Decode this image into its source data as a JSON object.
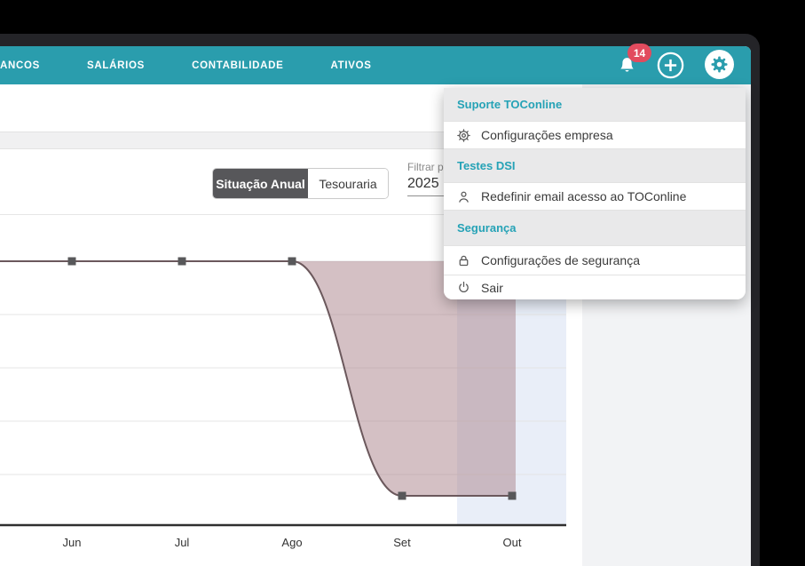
{
  "navbar": {
    "color": "#2A9DAD",
    "items": [
      {
        "label": "ANCOS"
      },
      {
        "label": "SALÁRIOS"
      },
      {
        "label": "CONTABILIDADE"
      },
      {
        "label": "ATIVOS"
      }
    ],
    "notifications": {
      "count": "14",
      "badge_color": "#E24B5E"
    }
  },
  "toolbar": {
    "tabs": [
      {
        "label": "Situação Anual",
        "active": true
      },
      {
        "label": "Tesouraria",
        "active": false
      }
    ],
    "filter": {
      "label": "Filtrar po",
      "value": "2025"
    }
  },
  "menu": {
    "header_color": "#25A2B6",
    "sections": [
      {
        "header": "Suporte TOConline",
        "items": [
          {
            "icon": "gear-icon",
            "label": "Configurações empresa"
          }
        ]
      },
      {
        "header": "Testes DSI",
        "items": [
          {
            "icon": "user-icon",
            "label": "Redefinir email acesso ao TOConline"
          }
        ]
      },
      {
        "header": "Segurança",
        "items": [
          {
            "icon": "lock-icon",
            "label": "Configurações de segurança"
          },
          {
            "icon": "power-icon",
            "label": "Sair"
          }
        ]
      }
    ]
  },
  "chart_data": {
    "type": "area",
    "categories": [
      "Jun",
      "Jul",
      "Ago",
      "Set",
      "Out"
    ],
    "values": [
      0,
      0,
      0,
      -4.4,
      -4.4
    ],
    "ylim": [
      -5.0,
      0.85
    ],
    "grid": true,
    "legend": false,
    "highlight_category": "Out",
    "title": "",
    "xlabel": "",
    "ylabel": "",
    "colors": {
      "line": "#6B585C",
      "fill": "#AA8289",
      "fill_opacity": 0.5,
      "marker": "#58585A",
      "band": "#E9EEF8",
      "axis": "#2F2F2F",
      "gridline": "#E4E4E4"
    }
  }
}
